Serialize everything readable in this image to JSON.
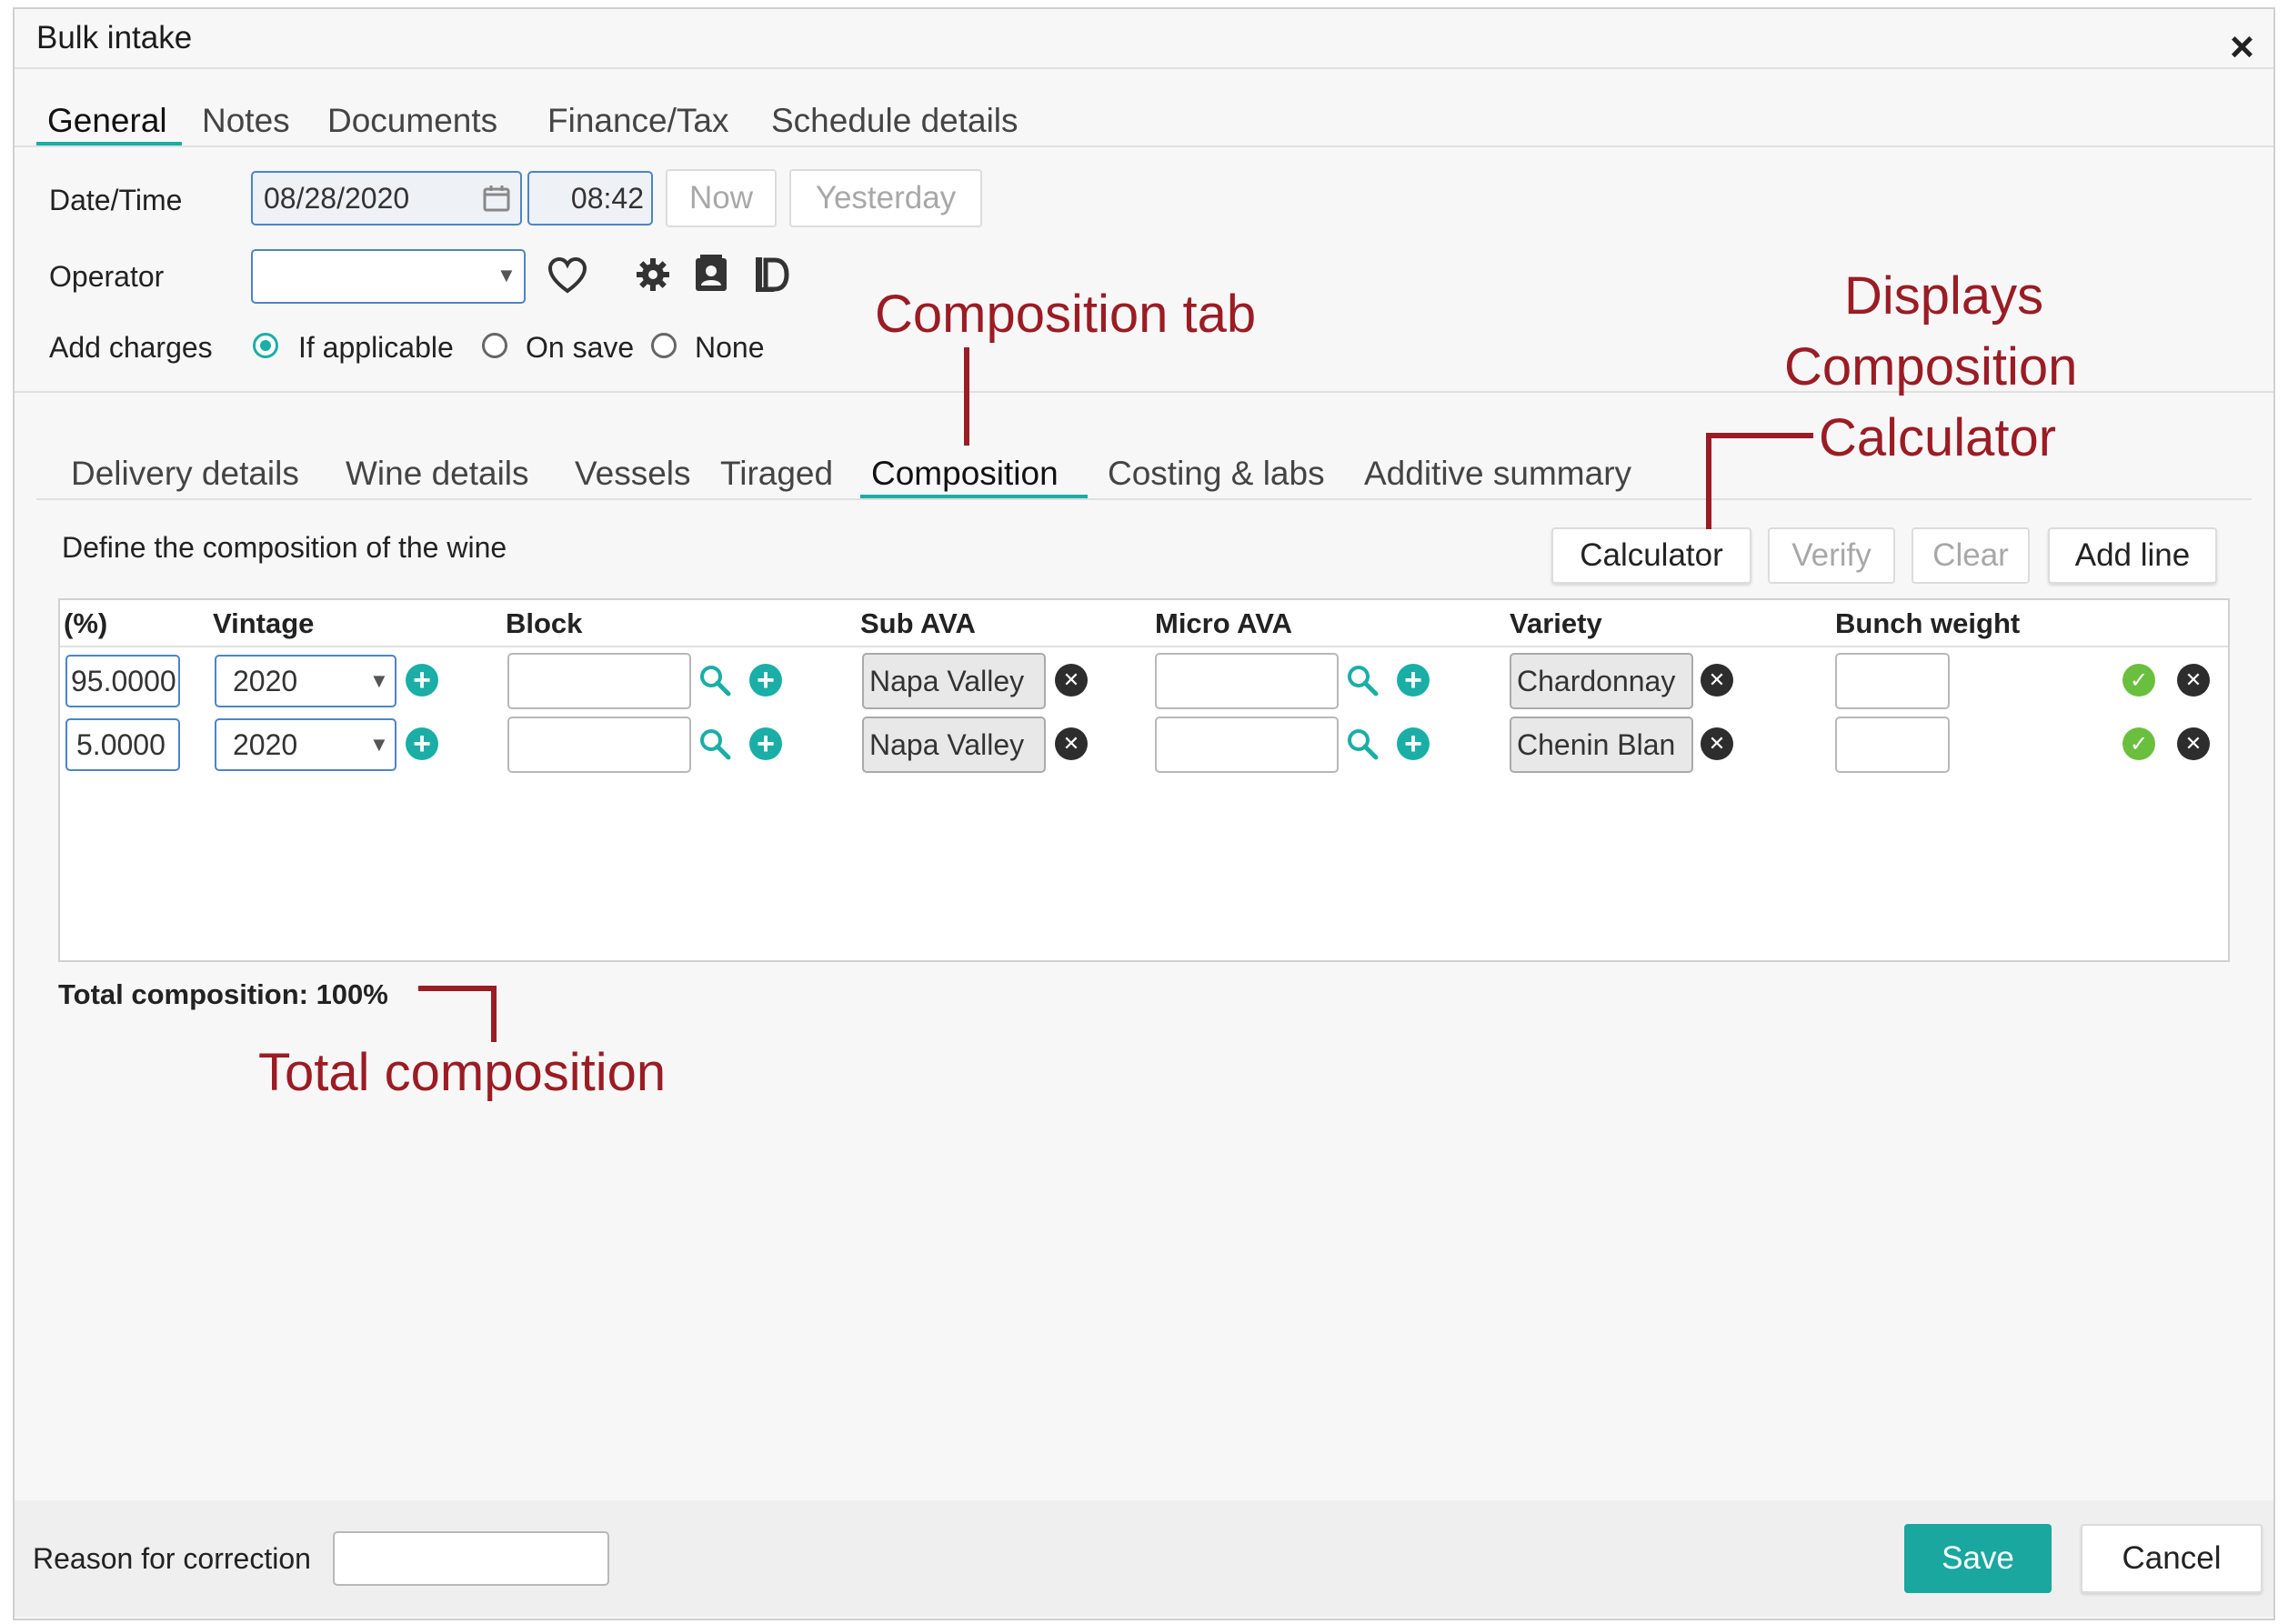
{
  "dialog": {
    "title": "Bulk intake",
    "close_label": "×"
  },
  "main_tabs": [
    {
      "label": "General",
      "active": true
    },
    {
      "label": "Notes"
    },
    {
      "label": "Documents"
    },
    {
      "label": "Finance/Tax"
    },
    {
      "label": "Schedule details"
    }
  ],
  "form": {
    "datetime_label": "Date/Time",
    "date_value": "08/28/2020",
    "time_value": "08:42",
    "now_button": "Now",
    "yesterday_button": "Yesterday",
    "operator_label": "Operator",
    "operator_value": "",
    "add_charges_label": "Add charges",
    "charge_options": [
      {
        "label": "If applicable",
        "selected": true
      },
      {
        "label": "On save"
      },
      {
        "label": "None"
      }
    ]
  },
  "sub_tabs": [
    {
      "label": "Delivery details"
    },
    {
      "label": "Wine details"
    },
    {
      "label": "Vessels"
    },
    {
      "label": "Tiraged"
    },
    {
      "label": "Composition",
      "active": true
    },
    {
      "label": "Costing & labs"
    },
    {
      "label": "Additive summary"
    }
  ],
  "composition": {
    "description": "Define the composition of the wine",
    "buttons": {
      "calculator": "Calculator",
      "verify": "Verify",
      "clear": "Clear",
      "add_line": "Add line"
    },
    "columns": [
      "(%)",
      "Vintage",
      "Block",
      "Sub AVA",
      "Micro AVA",
      "Variety",
      "Bunch weight"
    ],
    "rows": [
      {
        "percent": "95.0000",
        "vintage": "2020",
        "block": "",
        "sub_ava": "Napa Valley",
        "micro_ava": "",
        "variety": "Chardonnay",
        "bunch_weight": ""
      },
      {
        "percent": "5.0000",
        "vintage": "2020",
        "block": "",
        "sub_ava": "Napa Valley",
        "micro_ava": "",
        "variety": "Chenin Blan",
        "bunch_weight": ""
      }
    ],
    "total": "Total composition: 100%"
  },
  "footer": {
    "reason_label": "Reason for correction",
    "reason_value": "",
    "save_button": "Save",
    "cancel_button": "Cancel"
  },
  "annotations": {
    "composition_tab": "Composition tab",
    "calculator_line1": "Displays",
    "calculator_line2": "Composition",
    "calculator_line3": "Calculator",
    "total": "Total composition"
  },
  "colors": {
    "accent": "#1aaea6",
    "annotation": "#9b1c24",
    "save": "#19a79f"
  }
}
